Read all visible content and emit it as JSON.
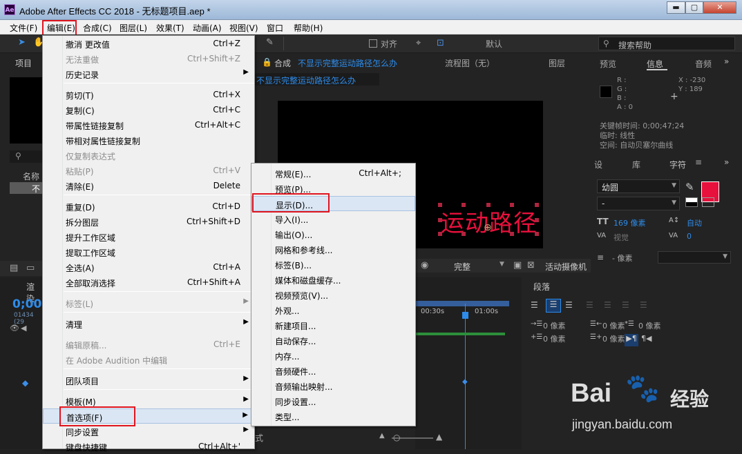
{
  "app": {
    "title": "Adobe After Effects CC 2018 - 无标题项目.aep *",
    "logo": "Ae"
  },
  "window_controls": [
    "minimize-icon",
    "maximize-icon",
    "close-icon"
  ],
  "menubar": [
    "文件(F)",
    "编辑(E)",
    "合成(C)",
    "图层(L)",
    "效果(T)",
    "动画(A)",
    "视图(V)",
    "窗口",
    "帮助(H)"
  ],
  "toolbar": {
    "snap_label": "对齐",
    "workspace": "默认",
    "search_placeholder": "搜索帮助"
  },
  "project_panel": {
    "tab": "项目",
    "name_col": "名称",
    "row_label": "不"
  },
  "comp_panel": {
    "tab_label": "合成",
    "comp_name": "不显示完整运动路径怎么办",
    "comp_name_short": "不显示完整运动路径怎么办",
    "flowchart": "流程图（无）",
    "layer_tab": "图层",
    "comp_text": "运动路径",
    "quality": "完整",
    "camera": "活动摄像机"
  },
  "info_panel": {
    "tabs": [
      "预览",
      "信息",
      "音频"
    ],
    "r": "R :",
    "g": "G :",
    "b": "B :",
    "a": "A : 0",
    "x": "X : -230",
    "y": "Y : 189",
    "kf_time": "关键帧时间: 0;00;47;24",
    "interp": "临时: 线性",
    "spatial": "空间: 自动贝塞尔曲线"
  },
  "char_panel": {
    "tabs": [
      "设",
      "库",
      "字符"
    ],
    "font": "幼圆",
    "style": "-",
    "size": "169 像素",
    "leading": "自动",
    "kerning": "视觉",
    "tracking": "0",
    "stroke": "- 像素",
    "fill_color": "#e8103c"
  },
  "para_panel": {
    "tab": "段落",
    "indent1": "0 像素",
    "indent2": "0 像素",
    "indent3": "0 像素",
    "space1": "0 像素",
    "space2": "0 像素"
  },
  "timeline": {
    "tab": "渲染",
    "time": "0;00;",
    "frames": "01434 (29",
    "tick1": "00:30s",
    "tick2": "01:00s",
    "mode": "式"
  },
  "edit_menu": {
    "items": [
      {
        "label": "撤消 更改值",
        "shortcut": "Ctrl+Z",
        "enabled": true
      },
      {
        "label": "无法重做",
        "shortcut": "Ctrl+Shift+Z",
        "enabled": false
      },
      {
        "label": "历史记录",
        "shortcut": "",
        "enabled": true,
        "submenu": true
      },
      {
        "label": "剪切(T)",
        "shortcut": "Ctrl+X",
        "enabled": true
      },
      {
        "label": "复制(C)",
        "shortcut": "Ctrl+C",
        "enabled": true
      },
      {
        "label": "带属性链接复制",
        "shortcut": "Ctrl+Alt+C",
        "enabled": true
      },
      {
        "label": "带相对属性链接复制",
        "shortcut": "",
        "enabled": true
      },
      {
        "label": "仅复制表达式",
        "shortcut": "",
        "enabled": false
      },
      {
        "label": "粘贴(P)",
        "shortcut": "Ctrl+V",
        "enabled": false
      },
      {
        "label": "清除(E)",
        "shortcut": "Delete",
        "enabled": true
      },
      {
        "label": "重复(D)",
        "shortcut": "Ctrl+D",
        "enabled": true
      },
      {
        "label": "拆分图层",
        "shortcut": "Ctrl+Shift+D",
        "enabled": true
      },
      {
        "label": "提升工作区域",
        "shortcut": "",
        "enabled": true
      },
      {
        "label": "提取工作区域",
        "shortcut": "",
        "enabled": true
      },
      {
        "label": "全选(A)",
        "shortcut": "Ctrl+A",
        "enabled": true
      },
      {
        "label": "全部取消选择",
        "shortcut": "Ctrl+Shift+A",
        "enabled": true
      },
      {
        "label": "标签(L)",
        "shortcut": "",
        "enabled": false,
        "submenu": true
      },
      {
        "label": "清理",
        "shortcut": "",
        "enabled": true,
        "submenu": true
      },
      {
        "label": "编辑原稿...",
        "shortcut": "Ctrl+E",
        "enabled": false
      },
      {
        "label": "在 Adobe Audition 中编辑",
        "shortcut": "",
        "enabled": false
      },
      {
        "label": "团队项目",
        "shortcut": "",
        "enabled": true,
        "submenu": true
      },
      {
        "label": "模板(M)",
        "shortcut": "",
        "enabled": true,
        "submenu": true
      },
      {
        "label": "首选项(F)",
        "shortcut": "",
        "enabled": true,
        "submenu": true,
        "highlighted": true
      },
      {
        "label": "同步设置",
        "shortcut": "",
        "enabled": true,
        "submenu": true
      },
      {
        "label": "键盘快捷键",
        "shortcut": "Ctrl+Alt+'",
        "enabled": true
      }
    ]
  },
  "prefs_menu": {
    "items": [
      {
        "label": "常规(E)...",
        "shortcut": "Ctrl+Alt+;"
      },
      {
        "label": "预览(P)..."
      },
      {
        "label": "显示(D)...",
        "highlighted": true
      },
      {
        "label": "导入(I)..."
      },
      {
        "label": "输出(O)..."
      },
      {
        "label": "网格和参考线..."
      },
      {
        "label": "标签(B)..."
      },
      {
        "label": "媒体和磁盘缓存..."
      },
      {
        "label": "视频预览(V)..."
      },
      {
        "label": "外观..."
      },
      {
        "label": "新建项目..."
      },
      {
        "label": "自动保存..."
      },
      {
        "label": "内存..."
      },
      {
        "label": "音频硬件..."
      },
      {
        "label": "音频输出映射..."
      },
      {
        "label": "同步设置..."
      },
      {
        "label": "类型..."
      }
    ]
  },
  "watermark": {
    "brand": "Bai",
    "brand2": "百度",
    "suffix": "经验",
    "url": "jingyan.baidu.com"
  }
}
